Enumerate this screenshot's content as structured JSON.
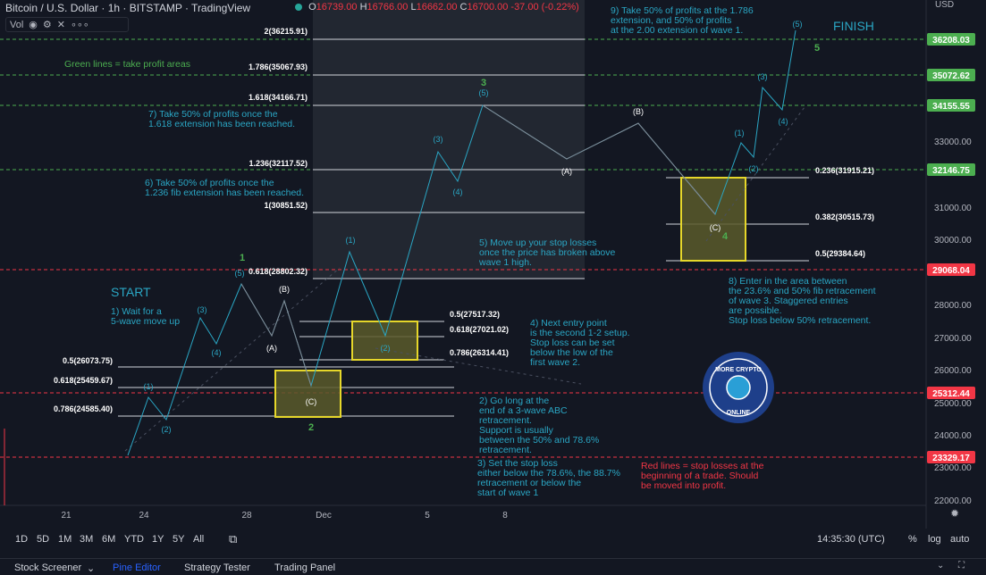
{
  "header": {
    "title": "Bitcoin / U.S. Dollar · 1h · BITSTAMP · TradingView",
    "ohlc": [
      {
        "k": "O",
        "v": "16739.00"
      },
      {
        "k": "H",
        "v": "16766.00"
      },
      {
        "k": "L",
        "v": "16662.00"
      },
      {
        "k": "C",
        "v": "16700.00"
      },
      {
        "k": "",
        "v": "-37.00 (-0.22%)"
      }
    ],
    "vol_label": "Vol",
    "currency": "USD"
  },
  "price_axis": {
    "ticks": [
      "33000.00",
      "31000.00",
      "30000.00",
      "28000.00",
      "27000.00",
      "26000.00",
      "25000.00",
      "24000.00",
      "23000.00",
      "22000.00"
    ],
    "labels": [
      {
        "text": "36208.03",
        "color": "#4caf50"
      },
      {
        "text": "35072.62",
        "color": "#4caf50"
      },
      {
        "text": "34155.55",
        "color": "#4caf50"
      },
      {
        "text": "32146.75",
        "color": "#4caf50"
      },
      {
        "text": "29068.04",
        "color": "#f23645"
      },
      {
        "text": "25312.44",
        "color": "#f23645"
      },
      {
        "text": "23329.17",
        "color": "#f23645"
      }
    ]
  },
  "time_axis": [
    "21",
    "24",
    "28",
    "Dec",
    "5",
    "8"
  ],
  "fib_labels": [
    "2(36215.91)",
    "1.786(35067.93)",
    "1.618(34166.71)",
    "1.236(32117.52)",
    "1(30851.52)",
    "0.618(28802.32)",
    "0.5(27517.32)",
    "0.618(27021.02)",
    "0.786(26314.41)",
    "0.5(26073.75)",
    "0.618(25459.67)",
    "0.786(24585.40)",
    "0.236(31915.21)",
    "0.382(30515.73)",
    "0.5(29384.64)"
  ],
  "wave_labels": [
    "(1)",
    "(2)",
    "(3)",
    "(4)",
    "(5)",
    "1",
    "(A)",
    "(B)",
    "(C)",
    "2",
    "(1)",
    "(2)",
    "(3)",
    "(4)",
    "(5)",
    "3",
    "(A)",
    "(B)",
    "(C)",
    "4",
    "(1)",
    "(2)",
    "(3)",
    "(4)",
    "(5)",
    "5"
  ],
  "annotations": {
    "green_note": "Green lines = take profit areas",
    "start": "START",
    "finish": "FINISH",
    "n1": [
      "1) Wait for a",
      "5-wave move up"
    ],
    "n2": [
      "2) Go long at the",
      "end of a 3-wave ABC",
      "retracement.",
      "Support is usually",
      "between the 50% and 78.6%",
      "retracement."
    ],
    "n3": [
      "3) Set the stop loss",
      "either below the 78.6%, the 88.7%",
      "retracement or below the",
      "start of wave 1"
    ],
    "n4": [
      "4) Next entry point",
      "is the second 1-2 setup.",
      "Stop loss can be set",
      "below the low of the",
      "first wave 2."
    ],
    "n5": [
      "5) Move up your stop losses",
      "once the price has broken above",
      "wave 1 high."
    ],
    "n6": [
      "6) Take 50% of profits once the",
      "1.236 fib extension has been reached."
    ],
    "n7": [
      "7) Take 50% of profits once the",
      "1.618 extension has been reached."
    ],
    "n8": [
      "8) Enter in the area between",
      "the 23.6% and 50% fib retracement",
      "of wave 3. Staggered entries",
      "are possible.",
      "Stop loss below 50% retracement."
    ],
    "n9": [
      "9) Take 50% of profits at the 1.786",
      "extension, and 50% of profits",
      "at the 2.00 extension of wave 1."
    ],
    "red_note": [
      "Red lines = stop losses at the",
      "beginning of a trade. Should",
      "be moved into profit."
    ]
  },
  "logo_text": [
    "MORE CRYPTO",
    "ONLINE"
  ],
  "timeframes": [
    "1D",
    "5D",
    "1M",
    "3M",
    "6M",
    "YTD",
    "1Y",
    "5Y",
    "All"
  ],
  "clock": "14:35:30 (UTC)",
  "chart_options": [
    "%",
    "log",
    "auto"
  ],
  "bottom_tabs": [
    "Stock Screener",
    "Pine Editor",
    "Strategy Tester",
    "Trading Panel"
  ],
  "colors": {
    "bg": "#131722",
    "green": "#4caf50",
    "red": "#f23645",
    "cyan": "#2aa6c4",
    "yellow": "#e6d72a",
    "accent": "#2962ff"
  }
}
